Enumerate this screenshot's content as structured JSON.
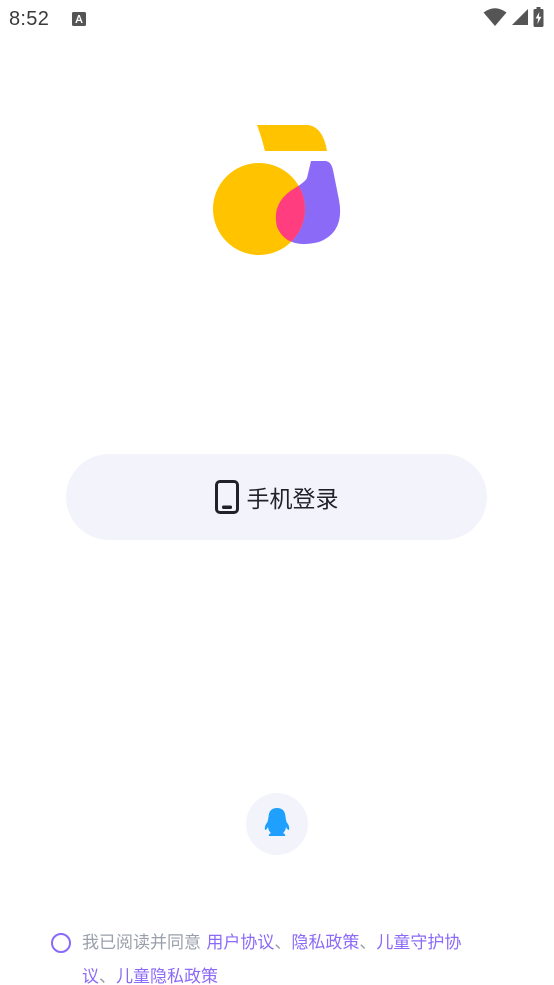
{
  "status_bar": {
    "time": "8:52",
    "icons": [
      "font-a-icon",
      "wifi-icon",
      "signal-icon",
      "battery-charging-icon"
    ]
  },
  "logo": {
    "icon": "music-note-logo-icon",
    "colors": {
      "yellow": "#FFC300",
      "purple": "#8B6AF7",
      "pink": "#FF3D7F"
    }
  },
  "login": {
    "icon": "phone-icon",
    "label": "手机登录"
  },
  "qq_login": {
    "icon": "qq-penguin-icon",
    "color": "#1FA0FF"
  },
  "agreement": {
    "prefix": "我已阅读并同意 ",
    "user_agreement": "用户协议",
    "sep1": "、",
    "privacy_policy": "隐私政策",
    "sep2": "、",
    "child_protection": "儿童守护协议",
    "sep3": "、",
    "child_privacy": "儿童隐私政策"
  },
  "colors": {
    "accent": "#8B6AF7",
    "button_bg": "#F3F4FB",
    "muted_text": "#9AA0AB"
  }
}
